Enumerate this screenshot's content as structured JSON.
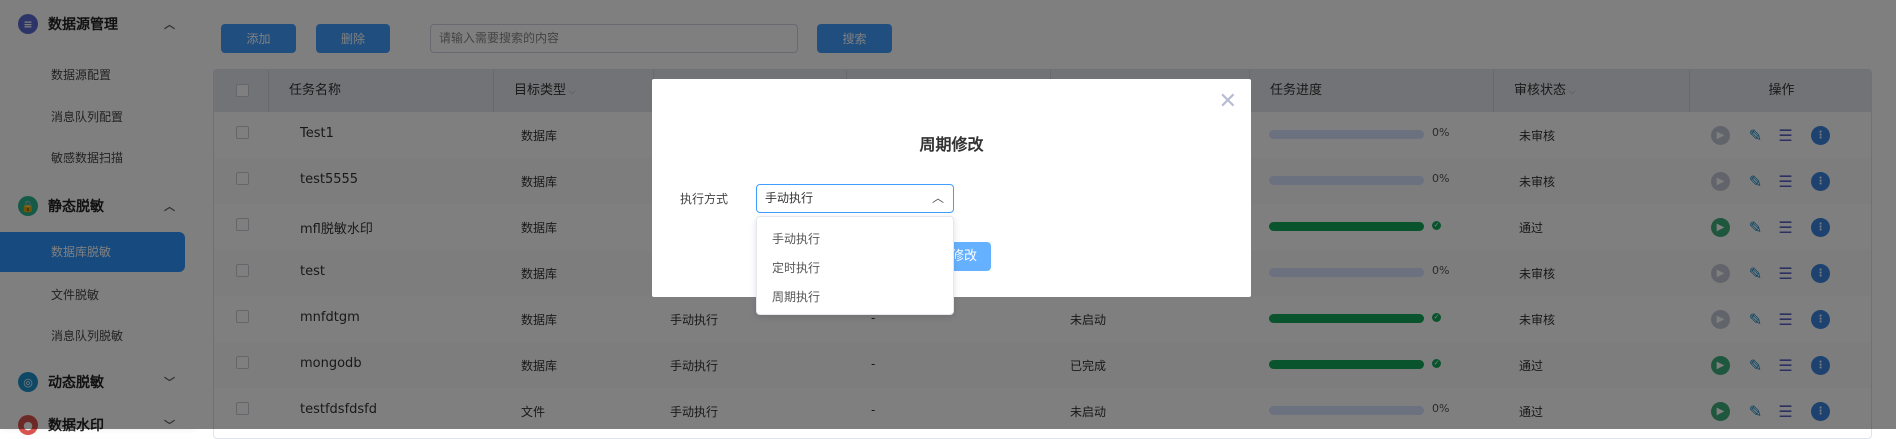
{
  "sidebar": {
    "groups": [
      {
        "label": "数据源管理",
        "icon": "database-icon",
        "color": "#5b6bd0",
        "expanded": true,
        "items": [
          "数据源配置",
          "消息队列配置",
          "敏感数据扫描"
        ]
      },
      {
        "label": "静态脱敏",
        "icon": "lock-icon",
        "color": "#2bb48c",
        "expanded": true,
        "items": [
          "数据库脱敏",
          "文件脱敏",
          "消息队列脱敏"
        ],
        "active": "数据库脱敏"
      },
      {
        "label": "动态脱敏",
        "icon": "dynamic-lock-icon",
        "color": "#1e90c8",
        "expanded": false,
        "items": []
      },
      {
        "label": "数据水印",
        "icon": "watermark-icon",
        "color": "#d9534f",
        "expanded": false,
        "items": []
      }
    ]
  },
  "toolbar": {
    "add_label": "添加",
    "delete_label": "删除",
    "search_placeholder": "请输入需要搜索的内容",
    "search_label": "搜索"
  },
  "table": {
    "headers": {
      "name": "任务名称",
      "target_type": "目标类型",
      "progress": "任务进度",
      "review": "审核状态",
      "actions": "操作"
    },
    "rows": [
      {
        "name": "Test1",
        "type": "数据库",
        "exec": null,
        "dash": null,
        "status": null,
        "progress": 0,
        "progress_label": "0%",
        "review": "未审核",
        "runnable": false
      },
      {
        "name": "test5555",
        "type": "数据库",
        "exec": null,
        "dash": null,
        "status": null,
        "progress": 0,
        "progress_label": "0%",
        "review": "未审核",
        "runnable": false
      },
      {
        "name": "mfl脱敏水印",
        "type": "数据库",
        "exec": null,
        "dash": null,
        "status": null,
        "progress": 100,
        "progress_label": "",
        "review": "通过",
        "runnable": true
      },
      {
        "name": "test",
        "type": "数据库",
        "exec": null,
        "dash": null,
        "status": null,
        "progress": 0,
        "progress_label": "0%",
        "review": "未审核",
        "runnable": false
      },
      {
        "name": "mnfdtgm",
        "type": "数据库",
        "exec": "手动执行",
        "dash": "-",
        "status": "未启动",
        "progress": 100,
        "progress_label": "",
        "review": "未审核",
        "runnable": false
      },
      {
        "name": "mongodb",
        "type": "数据库",
        "exec": "手动执行",
        "dash": "-",
        "status": "已完成",
        "progress": 100,
        "progress_label": "",
        "review": "通过",
        "runnable": true
      },
      {
        "name": "testfdsfdsfd",
        "type": "文件",
        "exec": "手动执行",
        "dash": "-",
        "status": "未启动",
        "progress": 0,
        "progress_label": "0%",
        "review": "通过",
        "runnable": true
      }
    ]
  },
  "modal": {
    "title": "周期修改",
    "close_icon": "close-icon",
    "field_label": "执行方式",
    "select_value": "手动执行",
    "options": [
      "手动执行",
      "定时执行",
      "周期执行"
    ],
    "confirm_label": "修改"
  },
  "colors": {
    "primary": "#409eff",
    "success": "#13a85a",
    "active_menu": "#2e94fc"
  }
}
